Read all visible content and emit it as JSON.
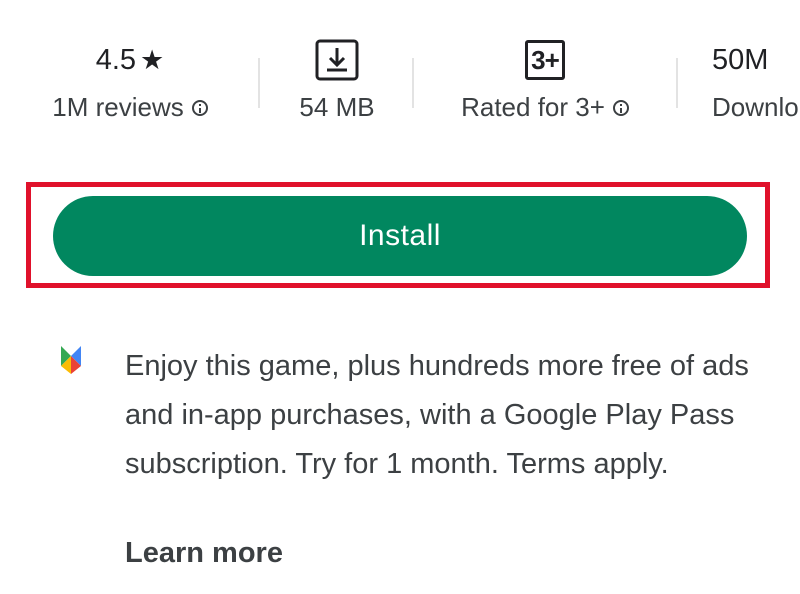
{
  "stats": {
    "rating": {
      "value": "4.5",
      "star": "★",
      "label": "1M reviews"
    },
    "size": {
      "icon": "download-icon",
      "label": "54 MB"
    },
    "content_rating": {
      "badge": "3+",
      "label": "Rated for 3+"
    },
    "downloads": {
      "value": "50M",
      "label": "Downlo"
    }
  },
  "install_button": {
    "label": "Install",
    "color": "#01875f"
  },
  "highlight_color": "#e0112b",
  "promo": {
    "icon": "play-pass-icon",
    "text": "Enjoy this game, plus hundreds more free of ads and in-app purchases, with a Google Play Pass subscription. Try for 1 month. Terms apply.",
    "link": "Learn more"
  }
}
